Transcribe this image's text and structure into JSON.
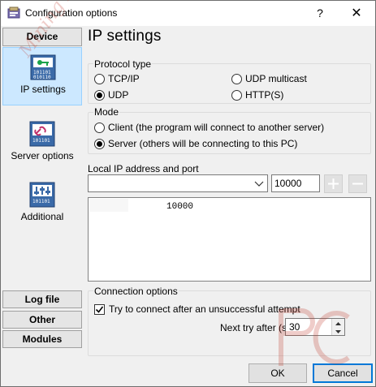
{
  "window": {
    "title": "Configuration options",
    "help_glyph": "?",
    "close_glyph": "✕"
  },
  "sidebar": {
    "device_label": "Device",
    "items": [
      {
        "label": "IP settings",
        "icon": "ip-settings-icon",
        "active": true
      },
      {
        "label": "Server options",
        "icon": "chain-link-icon",
        "active": false
      },
      {
        "label": "Additional",
        "icon": "sliders-icon",
        "active": false
      }
    ],
    "bottom_buttons": [
      "Log file",
      "Other",
      "Modules"
    ]
  },
  "main": {
    "heading": "IP settings",
    "protocol": {
      "label": "Protocol type",
      "options": [
        {
          "label": "TCP/IP",
          "selected": false
        },
        {
          "label": "UDP multicast",
          "selected": false
        },
        {
          "label": "UDP",
          "selected": true
        },
        {
          "label": "HTTP(S)",
          "selected": false
        }
      ]
    },
    "mode": {
      "label": "Mode",
      "options": [
        {
          "label": "Client (the program will connect to another server)",
          "selected": false
        },
        {
          "label": "Server (others will be connecting to this PC)",
          "selected": true
        }
      ]
    },
    "address": {
      "label": "Local IP address and port",
      "ip_value": "",
      "port_value": "10000",
      "list_rows": [
        "10000"
      ]
    },
    "connection": {
      "label": "Connection options",
      "retry_label": "Try to connect after an unsuccessful attempt",
      "retry_checked": true,
      "next_try_label": "Next try after (s)",
      "next_try_value": "30"
    }
  },
  "footer": {
    "ok_label": "OK",
    "cancel_label": "Cancel"
  },
  "watermark": {
    "text": "Mining PC"
  },
  "colors": {
    "active_bg": "#cce8ff",
    "accent": "#0078d7",
    "watermark": "#c0392b"
  }
}
